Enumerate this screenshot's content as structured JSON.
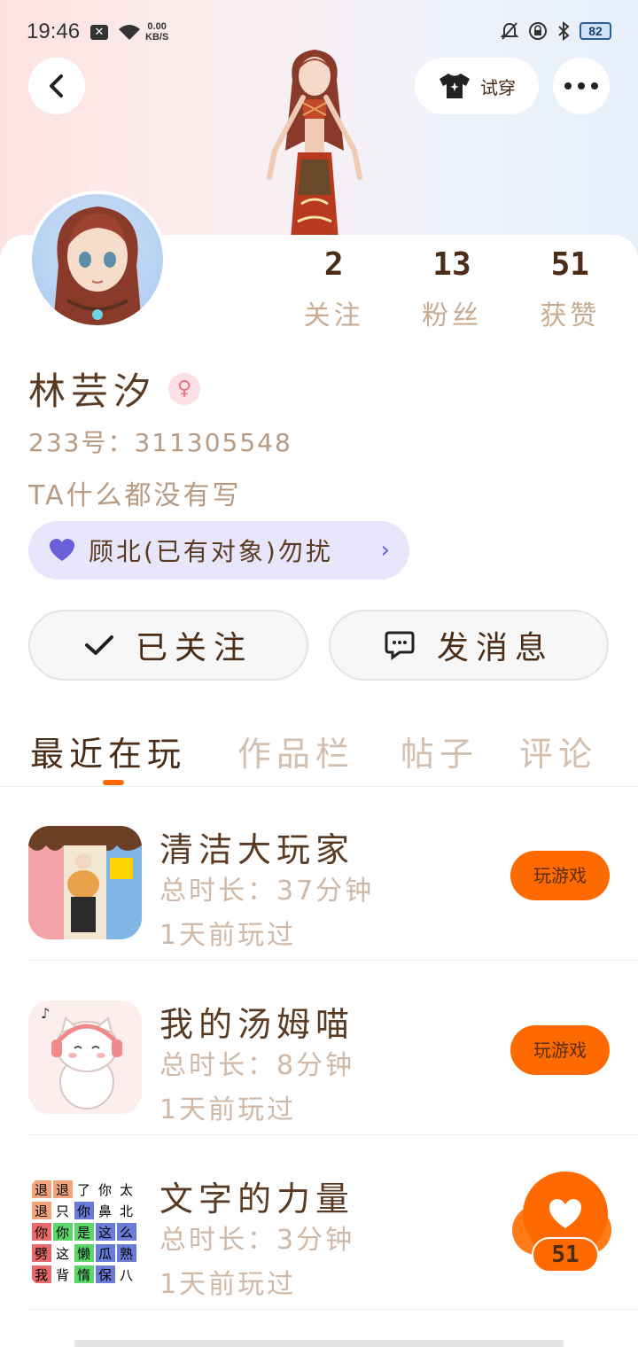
{
  "status": {
    "time": "19:46",
    "net_speed_value": "0.00",
    "net_speed_unit": "KB/S",
    "battery": "82"
  },
  "header": {
    "try_on_label": "试穿"
  },
  "profile": {
    "stats": [
      {
        "value": "2",
        "label": "关注"
      },
      {
        "value": "13",
        "label": "粉丝"
      },
      {
        "value": "51",
        "label": "获赞"
      }
    ],
    "name": "林芸汐",
    "gender_icon": "female-icon",
    "uid": "233号：311305548",
    "bio": "TA什么都没有写",
    "cp_tag": "顾北(已有对象)勿扰"
  },
  "actions": {
    "follow_label": "已关注",
    "message_label": "发消息"
  },
  "tabs": [
    "最近在玩",
    "作品栏",
    "帖子",
    "评论"
  ],
  "games": [
    {
      "title": "清洁大玩家",
      "time": "总时长：37分钟",
      "last": "1天前玩过",
      "button": "玩游戏"
    },
    {
      "title": "我的汤姆喵",
      "time": "总时长：8分钟",
      "last": "1天前玩过",
      "button": "玩游戏"
    },
    {
      "title": "文字的力量",
      "time": "总时长：3分钟",
      "last": "1天前玩过"
    }
  ],
  "like_fab": {
    "count": "51"
  },
  "colors": {
    "accent": "#ff6a00",
    "text": "#5a3a22",
    "muted": "#c9ab92",
    "cp_bg": "#e7e6fb"
  }
}
